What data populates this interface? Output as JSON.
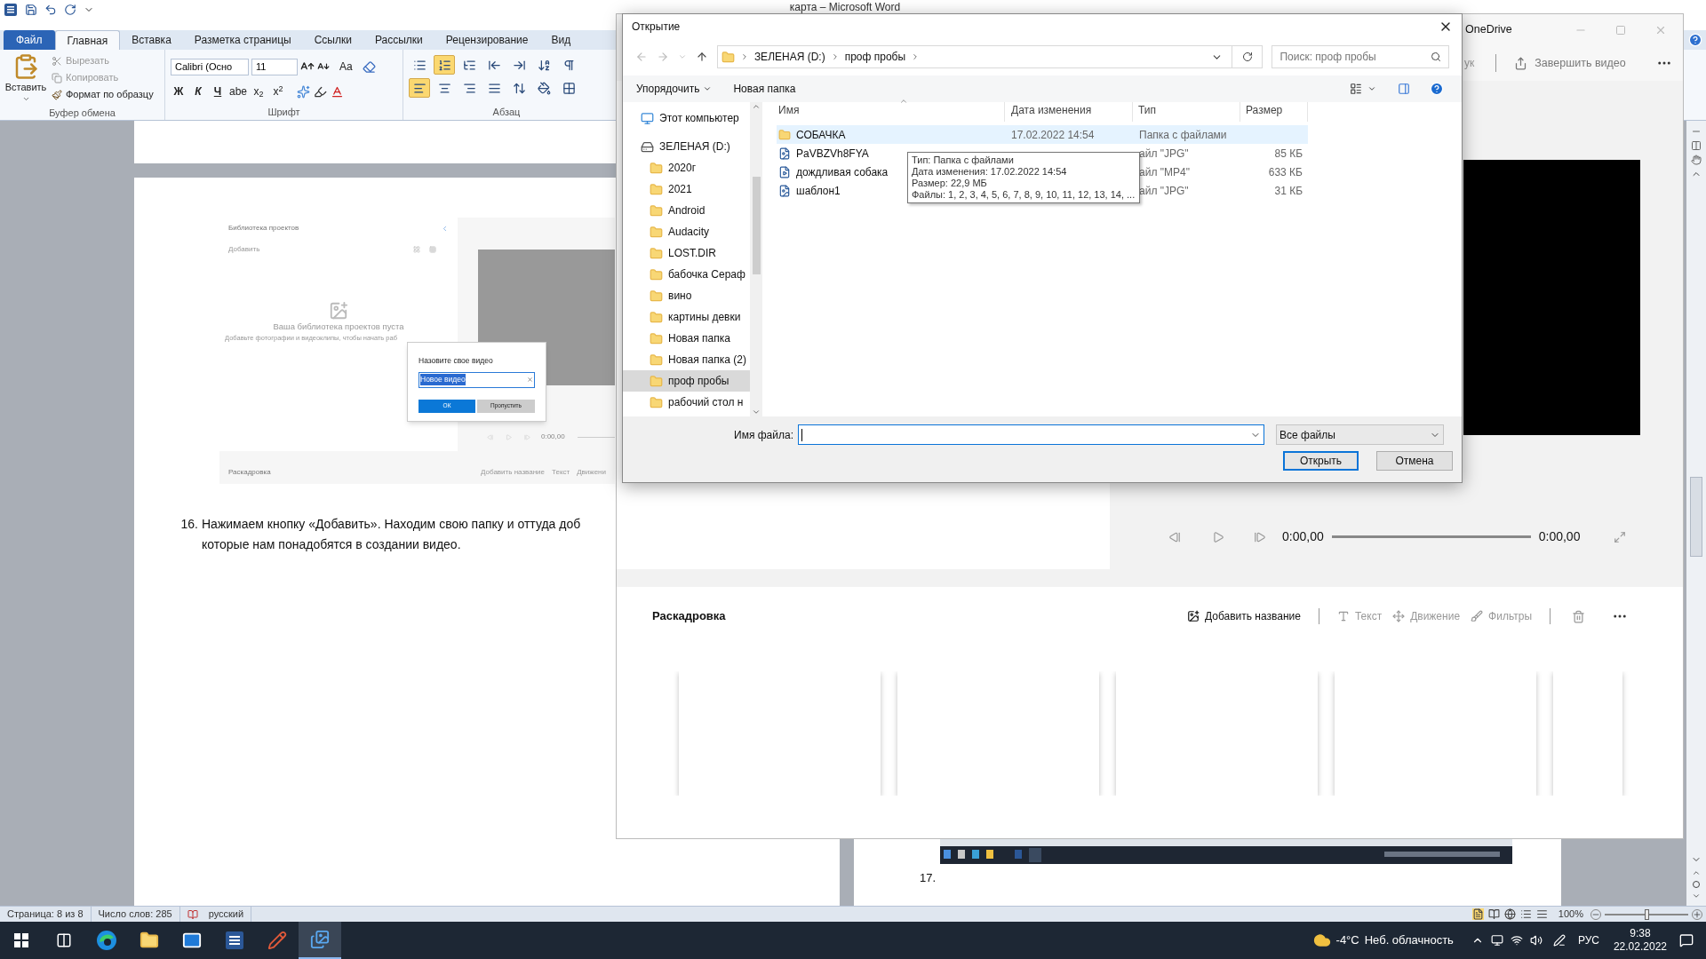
{
  "word": {
    "title": "карта – Microsoft Word",
    "tabs": [
      {
        "label": "Файл",
        "kind": "backstage",
        "selected": false
      },
      {
        "label": "Главная",
        "kind": "tab",
        "selected": true
      },
      {
        "label": "Вставка",
        "kind": "tab",
        "selected": false
      },
      {
        "label": "Разметка страницы",
        "kind": "tab",
        "selected": false
      },
      {
        "label": "Ссылки",
        "kind": "tab",
        "selected": false
      },
      {
        "label": "Рассылки",
        "kind": "tab",
        "selected": false
      },
      {
        "label": "Рецензирование",
        "kind": "tab",
        "selected": false
      },
      {
        "label": "Вид",
        "kind": "tab",
        "selected": false
      }
    ],
    "clipboard": {
      "paste": "Вставить",
      "group_label": "Буфер обмена",
      "tools": [
        {
          "label": "Вырезать",
          "kind": "cut",
          "disabled": true
        },
        {
          "label": "Копировать",
          "kind": "copy",
          "disabled": true
        },
        {
          "label": "Формат по образцу",
          "kind": "painter",
          "disabled": false
        }
      ]
    },
    "font": {
      "name": "Calibri (Осно",
      "size": "11",
      "case_button": "Aa",
      "style_buttons": [
        "Ж",
        "К",
        "Ч",
        "abe",
        "x$_{2}$",
        "x$^{2}$"
      ],
      "group_label": "Шрифт"
    },
    "paragraph": {
      "group_label": "Абзац",
      "tools_row_1": [
        {
          "kind": "bullets",
          "selected": false
        },
        {
          "kind": "numbering",
          "selected": true
        },
        {
          "kind": "multilevel",
          "selected": false
        },
        {
          "kind": "outdent",
          "selected": false
        },
        {
          "kind": "indent",
          "selected": false
        },
        {
          "kind": "sort",
          "selected": false
        },
        {
          "kind": "marks",
          "selected": false
        }
      ],
      "tools_row_2": [
        {
          "kind": "align_left",
          "selected": true
        },
        {
          "kind": "align_center",
          "selected": false
        },
        {
          "kind": "align_right",
          "selected": false
        },
        {
          "kind": "justify",
          "selected": false
        },
        {
          "kind": "line_spacing",
          "selected": false
        },
        {
          "kind": "shading",
          "selected": false
        },
        {
          "kind": "borders",
          "selected": false
        }
      ]
    },
    "document": {
      "embedded_screenshot": {
        "library_title": "Библиотека проектов",
        "add": "Добавить",
        "empty_title": "Ваша библиотека проектов пуста",
        "empty_hint": "Добавьте фотографии и видеоклипы, чтобы начать раб",
        "time": "0:00,00",
        "storyboard": "Раскадровка",
        "tools": [
          "Добавить название",
          "Текст",
          "Движени"
        ],
        "name_prompt": {
          "title": "Назовите свое видео",
          "value": "Новое видео",
          "ok": "ОК",
          "skip": "Пропустить"
        }
      },
      "list_number": "16.",
      "paragraph_lines": [
        "Нажимаем кнопку «Добавить». Находим свою папку и оттуда доб",
        "которые нам понадобятся в создании видео."
      ],
      "next_number": "17."
    },
    "status_bar": {
      "page": "Страница: 8 из 8",
      "words": "Число слов: 285",
      "language": "русский",
      "zoom": "100%",
      "zoom_slider": {
        "level": 0.5
      }
    }
  },
  "video_editor": {
    "title": "OneDrive",
    "partial_action": "ук",
    "finish": "Завершить видео",
    "time_current": "0:00,00",
    "time_total": "0:00,00",
    "storyboard_title": "Раскадровка",
    "storyboard_tools": [
      {
        "label": "Добавить название",
        "kind": "title",
        "disabled": false
      },
      {
        "label": "Текст",
        "kind": "text",
        "disabled": true
      },
      {
        "label": "Движение",
        "kind": "motion",
        "disabled": true
      },
      {
        "label": "Фильтры",
        "kind": "filters",
        "disabled": true
      }
    ]
  },
  "open_dialog": {
    "title": "Открытие",
    "path": [
      "ЗЕЛЕНАЯ (D:)",
      "проф пробы"
    ],
    "search": {
      "placeholder": "Поиск: проф пробы"
    },
    "organize": "Упорядочить",
    "new_folder": "Новая папка",
    "tree": [
      {
        "label": "Этот компьютер",
        "kind": "computer",
        "selected": false
      },
      {
        "label": "ЗЕЛЕНАЯ (D:)",
        "kind": "drive",
        "selected": false,
        "children": [
          {
            "label": "2020г",
            "kind": "folder",
            "selected": false
          },
          {
            "label": "2021",
            "kind": "folder",
            "selected": false
          },
          {
            "label": "Android",
            "kind": "folder",
            "selected": false
          },
          {
            "label": "Audacity",
            "kind": "folder",
            "selected": false
          },
          {
            "label": "LOST.DIR",
            "kind": "folder",
            "selected": false
          },
          {
            "label": "бабочка Сераф",
            "kind": "folder",
            "selected": false
          },
          {
            "label": "вино",
            "kind": "folder",
            "selected": false
          },
          {
            "label": "картины девки",
            "kind": "folder",
            "selected": false
          },
          {
            "label": "Новая папка",
            "kind": "folder",
            "selected": false
          },
          {
            "label": "Новая папка (2)",
            "kind": "folder",
            "selected": false
          },
          {
            "label": "проф пробы",
            "kind": "folder",
            "selected": true
          },
          {
            "label": "рабочий стол н",
            "kind": "folder",
            "selected": false
          }
        ]
      }
    ],
    "columns": [
      "Имя",
      "Дата изменения",
      "Тип",
      "Размер"
    ],
    "files": [
      {
        "kind": "folder",
        "name": "СОБАЧКА",
        "date": "17.02.2022 14:54",
        "type": "Папка с файлами",
        "highlighted": true
      },
      {
        "kind": "image",
        "name": "PaVBZVh8FYA",
        "type": "айл \"JPG\"",
        "size": "85 КБ",
        "highlighted": false
      },
      {
        "kind": "video",
        "name": "дождливая собака",
        "type": "айл \"MP4\"",
        "size": "633 КБ",
        "highlighted": false
      },
      {
        "kind": "image",
        "name": "шаблон1",
        "type": "айл \"JPG\"",
        "size": "31 КБ",
        "highlighted": false
      }
    ],
    "tooltip": [
      "Тип: Папка с файлами",
      "Дата изменения: 17.02.2022 14:54",
      "Размер: 22,9 МБ",
      "Файлы: 1, 2, 3, 4, 5, 6, 7, 8, 9, 10, 11, 12, 13, 14, ..."
    ],
    "file_name_label": "Имя файла:",
    "file_type": "Все файлы",
    "open_button": "Открыть",
    "cancel_button": "Отмена"
  },
  "taskbar": {
    "apps": [
      {
        "kind": "start",
        "selected": false
      },
      {
        "kind": "task_view",
        "selected": false
      },
      {
        "kind": "browser",
        "selected": false
      },
      {
        "kind": "explorer",
        "selected": false
      },
      {
        "kind": "mail",
        "selected": false
      },
      {
        "kind": "word",
        "selected": false
      },
      {
        "kind": "paint",
        "selected": false
      },
      {
        "kind": "photos",
        "selected": true
      }
    ],
    "temperature": "-4°C",
    "weather": "Неб. облачность",
    "language": "РУС",
    "time": "9:38",
    "date": "22.02.2022"
  }
}
